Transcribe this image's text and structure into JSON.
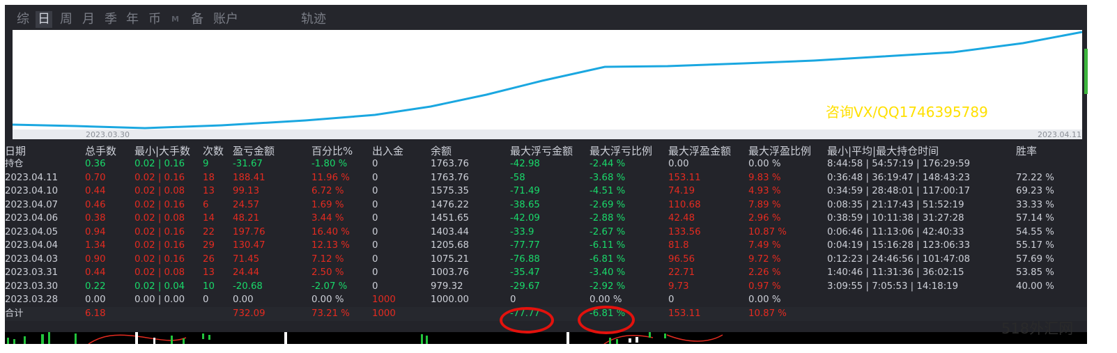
{
  "tabs": [
    {
      "label": "综",
      "active": false
    },
    {
      "label": "日",
      "active": true
    },
    {
      "label": "周",
      "active": false
    },
    {
      "label": "月",
      "active": false
    },
    {
      "label": "季",
      "active": false
    },
    {
      "label": "年",
      "active": false
    },
    {
      "label": "币",
      "active": false
    },
    {
      "label": "M",
      "active": false
    },
    {
      "label": "备",
      "active": false
    },
    {
      "label": "账户",
      "active": false
    },
    {
      "label": "轨迹",
      "active": false
    }
  ],
  "chart": {
    "start_date": "2023.03.30",
    "end_date": "2023.04.11",
    "overlay_text": "咨询VX/QQ1746395789",
    "line_color": "#1aa7e0",
    "overlay_color": "#ffe000"
  },
  "table": {
    "headers": [
      "日期",
      "总手数",
      "最小|大手数",
      "次数",
      "盈亏金额",
      "百分比%",
      "出入金",
      "余额",
      "最大浮亏金额",
      "最大浮亏比例",
      "最大浮盈金额",
      "最大浮盈比例",
      "最小|平均|最大持仓时间",
      "胜率"
    ],
    "rows": [
      {
        "cells": [
          "持仓",
          "0.36",
          "0.02 | 0.16",
          "9",
          "-31.67",
          "-1.80 %",
          "0",
          "1763.76",
          "-42.98",
          "-2.44 %",
          "0.00",
          "0.00 %",
          "8:44:58 | 54:57:19 | 176:29:59",
          ""
        ],
        "colors": "wgggggwwggwwww"
      },
      {
        "cells": [
          "2023.04.11",
          "0.70",
          "0.02 | 0.16",
          "18",
          "188.41",
          "11.96 %",
          "0",
          "1763.76",
          "-58",
          "-3.68 %",
          "153.11",
          "9.83 %",
          "0:36:48 | 36:19:47 | 148:43:23",
          "72.22 %"
        ],
        "colors": "wrrrrrwwggrrww"
      },
      {
        "cells": [
          "2023.04.10",
          "0.44",
          "0.02 | 0.08",
          "13",
          "99.13",
          "6.72 %",
          "0",
          "1575.35",
          "-71.49",
          "-4.51 %",
          "74.19",
          "4.93 %",
          "0:34:59 | 28:48:01 | 117:00:17",
          "69.23 %"
        ],
        "colors": "wrrrrrwwggrrww"
      },
      {
        "cells": [
          "2023.04.07",
          "0.46",
          "0.02 | 0.16",
          "6",
          "24.57",
          "1.69 %",
          "0",
          "1476.22",
          "-38.65",
          "-2.69 %",
          "110.68",
          "7.89 %",
          "0:08:35 | 21:17:43 | 51:52:19",
          "33.33 %"
        ],
        "colors": "wrrrrrwwggrrww"
      },
      {
        "cells": [
          "2023.04.06",
          "0.38",
          "0.02 | 0.08",
          "14",
          "48.21",
          "3.44 %",
          "0",
          "1451.65",
          "-42.09",
          "-2.88 %",
          "42.48",
          "2.96 %",
          "0:38:59 | 10:11:38 | 31:27:28",
          "57.14 %"
        ],
        "colors": "wrrrrrwwggrrww"
      },
      {
        "cells": [
          "2023.04.05",
          "0.94",
          "0.02 | 0.16",
          "22",
          "197.76",
          "16.40 %",
          "0",
          "1403.44",
          "-33.9",
          "-2.67 %",
          "133.56",
          "10.87 %",
          "0:06:46 | 11:13:06 | 42:40:33",
          "54.55 %"
        ],
        "colors": "wrrrrrwwggrrww"
      },
      {
        "cells": [
          "2023.04.04",
          "1.34",
          "0.02 | 0.16",
          "29",
          "130.47",
          "12.13 %",
          "0",
          "1205.68",
          "-77.77",
          "-6.11 %",
          "81.8",
          "7.49 %",
          "0:04:19 | 15:16:28 | 123:06:33",
          "55.17 %"
        ],
        "colors": "wrrrrrwwggrrww"
      },
      {
        "cells": [
          "2023.04.03",
          "0.90",
          "0.02 | 0.16",
          "26",
          "71.45",
          "7.12 %",
          "0",
          "1075.21",
          "-76.88",
          "-6.81 %",
          "96.56",
          "9.72 %",
          "0:12:23 | 24:46:56 | 101:47:08",
          "57.69 %"
        ],
        "colors": "wrrrrrwwggrrww"
      },
      {
        "cells": [
          "2023.03.31",
          "0.44",
          "0.02 | 0.08",
          "13",
          "24.44",
          "2.50 %",
          "0",
          "1003.76",
          "-35.47",
          "-3.40 %",
          "22.71",
          "2.26 %",
          "1:40:46 | 11:31:36 | 36:02:15",
          "53.85 %"
        ],
        "colors": "wrrrrrwwggrrww"
      },
      {
        "cells": [
          "2023.03.30",
          "0.22",
          "0.02 | 0.04",
          "10",
          "-20.68",
          "-2.07 %",
          "0",
          "979.32",
          "-29.67",
          "-2.92 %",
          "9.73",
          "0.97 %",
          "3:09:55 | 7:05:53 | 14:18:19",
          "40.00 %"
        ],
        "colors": "wgggggwwggrrww"
      },
      {
        "cells": [
          "2023.03.28",
          "0.00",
          "0.00 | 0.00",
          "0",
          "0.00",
          "0.00 %",
          "1000",
          "1000.00",
          "0",
          "0.00 %",
          "0",
          "0.00 %",
          "",
          ""
        ],
        "colors": "wwwwwwrwwwwwww"
      }
    ],
    "total": {
      "cells": [
        "合计",
        "6.18",
        "",
        "",
        "732.09",
        "73.21 %",
        "1000",
        "",
        "-77.77",
        "-6.81 %",
        "153.11",
        "10.87 %",
        "",
        ""
      ],
      "colors": "wrrrrrrwggrrww"
    }
  },
  "watermark": "518外汇网"
}
